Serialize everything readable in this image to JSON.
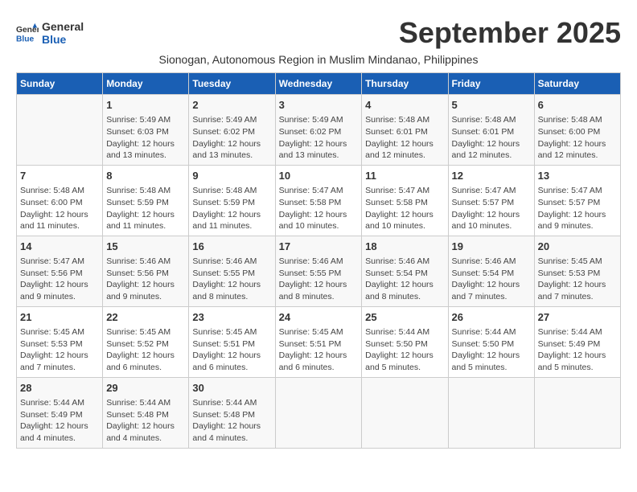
{
  "header": {
    "logo_line1": "General",
    "logo_line2": "Blue",
    "month_title": "September 2025",
    "subtitle": "Sionogan, Autonomous Region in Muslim Mindanao, Philippines"
  },
  "days_of_week": [
    "Sunday",
    "Monday",
    "Tuesday",
    "Wednesday",
    "Thursday",
    "Friday",
    "Saturday"
  ],
  "weeks": [
    [
      {
        "day": "",
        "info": ""
      },
      {
        "day": "1",
        "info": "Sunrise: 5:49 AM\nSunset: 6:03 PM\nDaylight: 12 hours\nand 13 minutes."
      },
      {
        "day": "2",
        "info": "Sunrise: 5:49 AM\nSunset: 6:02 PM\nDaylight: 12 hours\nand 13 minutes."
      },
      {
        "day": "3",
        "info": "Sunrise: 5:49 AM\nSunset: 6:02 PM\nDaylight: 12 hours\nand 13 minutes."
      },
      {
        "day": "4",
        "info": "Sunrise: 5:48 AM\nSunset: 6:01 PM\nDaylight: 12 hours\nand 12 minutes."
      },
      {
        "day": "5",
        "info": "Sunrise: 5:48 AM\nSunset: 6:01 PM\nDaylight: 12 hours\nand 12 minutes."
      },
      {
        "day": "6",
        "info": "Sunrise: 5:48 AM\nSunset: 6:00 PM\nDaylight: 12 hours\nand 12 minutes."
      }
    ],
    [
      {
        "day": "7",
        "info": "Sunrise: 5:48 AM\nSunset: 6:00 PM\nDaylight: 12 hours\nand 11 minutes."
      },
      {
        "day": "8",
        "info": "Sunrise: 5:48 AM\nSunset: 5:59 PM\nDaylight: 12 hours\nand 11 minutes."
      },
      {
        "day": "9",
        "info": "Sunrise: 5:48 AM\nSunset: 5:59 PM\nDaylight: 12 hours\nand 11 minutes."
      },
      {
        "day": "10",
        "info": "Sunrise: 5:47 AM\nSunset: 5:58 PM\nDaylight: 12 hours\nand 10 minutes."
      },
      {
        "day": "11",
        "info": "Sunrise: 5:47 AM\nSunset: 5:58 PM\nDaylight: 12 hours\nand 10 minutes."
      },
      {
        "day": "12",
        "info": "Sunrise: 5:47 AM\nSunset: 5:57 PM\nDaylight: 12 hours\nand 10 minutes."
      },
      {
        "day": "13",
        "info": "Sunrise: 5:47 AM\nSunset: 5:57 PM\nDaylight: 12 hours\nand 9 minutes."
      }
    ],
    [
      {
        "day": "14",
        "info": "Sunrise: 5:47 AM\nSunset: 5:56 PM\nDaylight: 12 hours\nand 9 minutes."
      },
      {
        "day": "15",
        "info": "Sunrise: 5:46 AM\nSunset: 5:56 PM\nDaylight: 12 hours\nand 9 minutes."
      },
      {
        "day": "16",
        "info": "Sunrise: 5:46 AM\nSunset: 5:55 PM\nDaylight: 12 hours\nand 8 minutes."
      },
      {
        "day": "17",
        "info": "Sunrise: 5:46 AM\nSunset: 5:55 PM\nDaylight: 12 hours\nand 8 minutes."
      },
      {
        "day": "18",
        "info": "Sunrise: 5:46 AM\nSunset: 5:54 PM\nDaylight: 12 hours\nand 8 minutes."
      },
      {
        "day": "19",
        "info": "Sunrise: 5:46 AM\nSunset: 5:54 PM\nDaylight: 12 hours\nand 7 minutes."
      },
      {
        "day": "20",
        "info": "Sunrise: 5:45 AM\nSunset: 5:53 PM\nDaylight: 12 hours\nand 7 minutes."
      }
    ],
    [
      {
        "day": "21",
        "info": "Sunrise: 5:45 AM\nSunset: 5:53 PM\nDaylight: 12 hours\nand 7 minutes."
      },
      {
        "day": "22",
        "info": "Sunrise: 5:45 AM\nSunset: 5:52 PM\nDaylight: 12 hours\nand 6 minutes."
      },
      {
        "day": "23",
        "info": "Sunrise: 5:45 AM\nSunset: 5:51 PM\nDaylight: 12 hours\nand 6 minutes."
      },
      {
        "day": "24",
        "info": "Sunrise: 5:45 AM\nSunset: 5:51 PM\nDaylight: 12 hours\nand 6 minutes."
      },
      {
        "day": "25",
        "info": "Sunrise: 5:44 AM\nSunset: 5:50 PM\nDaylight: 12 hours\nand 5 minutes."
      },
      {
        "day": "26",
        "info": "Sunrise: 5:44 AM\nSunset: 5:50 PM\nDaylight: 12 hours\nand 5 minutes."
      },
      {
        "day": "27",
        "info": "Sunrise: 5:44 AM\nSunset: 5:49 PM\nDaylight: 12 hours\nand 5 minutes."
      }
    ],
    [
      {
        "day": "28",
        "info": "Sunrise: 5:44 AM\nSunset: 5:49 PM\nDaylight: 12 hours\nand 4 minutes."
      },
      {
        "day": "29",
        "info": "Sunrise: 5:44 AM\nSunset: 5:48 PM\nDaylight: 12 hours\nand 4 minutes."
      },
      {
        "day": "30",
        "info": "Sunrise: 5:44 AM\nSunset: 5:48 PM\nDaylight: 12 hours\nand 4 minutes."
      },
      {
        "day": "",
        "info": ""
      },
      {
        "day": "",
        "info": ""
      },
      {
        "day": "",
        "info": ""
      },
      {
        "day": "",
        "info": ""
      }
    ]
  ]
}
